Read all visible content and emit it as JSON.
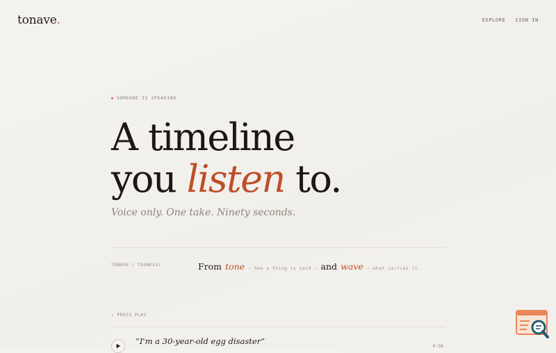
{
  "brand": {
    "name": "tonave",
    "dot": "."
  },
  "nav": {
    "explore": "EXPLORE",
    "sign_in": "SIGN IN"
  },
  "eyebrow": "SOMEONE IS SPEAKING",
  "hero": {
    "line1": "A timeline",
    "line2_prefix": "you",
    "line2_accent": "listen",
    "line2_suffix": "to."
  },
  "tagline": "Voice only. One take. Ninety seconds.",
  "etymology": {
    "left": "TONAVE / TOʊNEɪV/",
    "from": "From",
    "tone": "tone",
    "tone_gloss": "— how a thing is said —",
    "and": "and",
    "wave": "wave",
    "wave_gloss": "— what carries it."
  },
  "press_play": "↓ PRESS PLAY",
  "track": {
    "title": "“I'm a 30-year-old egg disaster”",
    "duration": "0:36"
  },
  "colors": {
    "accent": "#bf4e2b",
    "background": "#f3f1ec",
    "text": "#1e1b18"
  },
  "icons": {
    "play": "play-icon",
    "badge": "search-window-icon"
  }
}
